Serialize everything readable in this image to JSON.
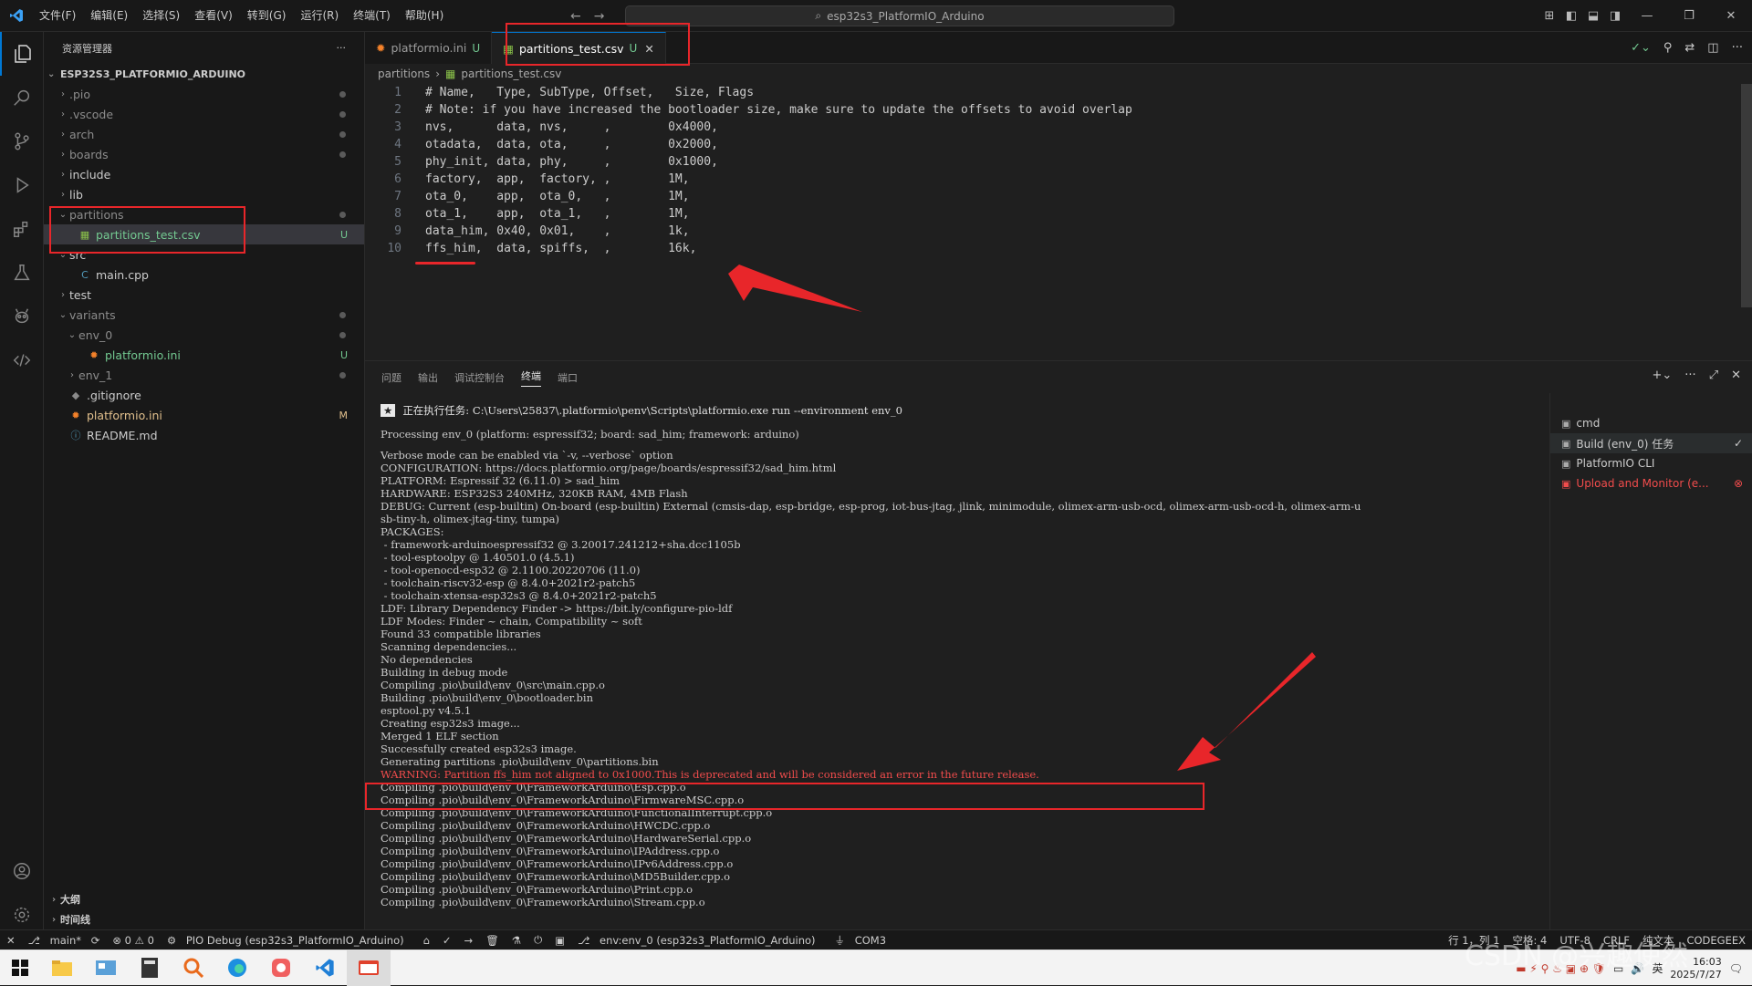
{
  "app": {
    "menu": [
      "文件(F)",
      "编辑(E)",
      "选择(S)",
      "查看(V)",
      "转到(G)",
      "运行(R)",
      "终端(T)",
      "帮助(H)"
    ],
    "search_text": "esp32s3_PlatformIO_Arduino"
  },
  "sidebar": {
    "title": "资源管理器",
    "root": "ESP32S3_PLATFORMIO_ARDUINO",
    "items": [
      {
        "label": ".pio",
        "type": "folder",
        "indent": 1,
        "open": false,
        "dot": true
      },
      {
        "label": ".vscode",
        "type": "folder",
        "indent": 1,
        "open": false,
        "dot": true
      },
      {
        "label": "arch",
        "type": "folder",
        "indent": 1,
        "open": false,
        "dot": true
      },
      {
        "label": "boards",
        "type": "folder",
        "indent": 1,
        "open": false,
        "dot": true
      },
      {
        "label": "include",
        "type": "folder",
        "indent": 1,
        "open": false,
        "dot": false
      },
      {
        "label": "lib",
        "type": "folder",
        "indent": 1,
        "open": false,
        "dot": false
      },
      {
        "label": "partitions",
        "type": "folder",
        "indent": 1,
        "open": true,
        "dot": true
      },
      {
        "label": "partitions_test.csv",
        "type": "csv",
        "indent": 2,
        "badge": "U",
        "selected": true
      },
      {
        "label": "src",
        "type": "folder",
        "indent": 1,
        "open": true,
        "dot": false
      },
      {
        "label": "main.cpp",
        "type": "cpp",
        "indent": 2
      },
      {
        "label": "test",
        "type": "folder",
        "indent": 1,
        "open": false,
        "dot": false
      },
      {
        "label": "variants",
        "type": "folder",
        "indent": 1,
        "open": true,
        "dot": true
      },
      {
        "label": "env_0",
        "type": "folder",
        "indent": 2,
        "open": true,
        "dot": true
      },
      {
        "label": "platformio.ini",
        "type": "ini",
        "indent": 3,
        "badge": "U"
      },
      {
        "label": "env_1",
        "type": "folder",
        "indent": 2,
        "open": false,
        "dot": true
      },
      {
        "label": ".gitignore",
        "type": "git",
        "indent": 1
      },
      {
        "label": "platformio.ini",
        "type": "ini",
        "indent": 1,
        "badge": "M"
      },
      {
        "label": "README.md",
        "type": "md",
        "indent": 1
      }
    ],
    "bottom": [
      "大纲",
      "时间线"
    ]
  },
  "editor": {
    "tabs": [
      {
        "label": "platformio.ini",
        "badge": "U",
        "active": false
      },
      {
        "label": "partitions_test.csv",
        "badge": "U",
        "active": true
      }
    ],
    "breadcrumb": [
      "partitions",
      "partitions_test.csv"
    ],
    "lines": [
      "# Name,   Type, SubType, Offset,   Size, Flags",
      "# Note: if you have increased the bootloader size, make sure to update the offsets to avoid overlap",
      "nvs,      data, nvs,     ,        0x4000,",
      "otadata,  data, ota,     ,        0x2000,",
      "phy_init, data, phy,     ,        0x1000,",
      "factory,  app,  factory, ,        1M,",
      "ota_0,    app,  ota_0,   ,        1M,",
      "ota_1,    app,  ota_1,   ,        1M,",
      "data_him, 0x40, 0x01,    ,        1k,",
      "ffs_him,  data, spiffs,  ,        16k,"
    ]
  },
  "panel": {
    "tabs": [
      "问题",
      "输出",
      "调试控制台",
      "终端",
      "端口"
    ],
    "active_tab": "终端",
    "task_line": "正在执行任务: C:\\Users\\25837\\.platformio\\penv\\Scripts\\platformio.exe run --environment env_0",
    "processing": "Processing env_0 (platform: espressif32; board: sad_him; framework: arduino)",
    "output": [
      "Verbose mode can be enabled via `-v, --verbose` option",
      "CONFIGURATION: https://docs.platformio.org/page/boards/espressif32/sad_him.html",
      "PLATFORM: Espressif 32 (6.11.0) > sad_him",
      "HARDWARE: ESP32S3 240MHz, 320KB RAM, 4MB Flash",
      "DEBUG: Current (esp-builtin) On-board (esp-builtin) External (cmsis-dap, esp-bridge, esp-prog, iot-bus-jtag, jlink, minimodule, olimex-arm-usb-ocd, olimex-arm-usb-ocd-h, olimex-arm-u",
      "sb-tiny-h, olimex-jtag-tiny, tumpa)",
      "PACKAGES:",
      " - framework-arduinoespressif32 @ 3.20017.241212+sha.dcc1105b",
      " - tool-esptoolpy @ 1.40501.0 (4.5.1)",
      " - tool-openocd-esp32 @ 2.1100.20220706 (11.0)",
      " - toolchain-riscv32-esp @ 8.4.0+2021r2-patch5",
      " - toolchain-xtensa-esp32s3 @ 8.4.0+2021r2-patch5",
      "LDF: Library Dependency Finder -> https://bit.ly/configure-pio-ldf",
      "LDF Modes: Finder ~ chain, Compatibility ~ soft",
      "Found 33 compatible libraries",
      "Scanning dependencies...",
      "No dependencies",
      "Building in debug mode",
      "Compiling .pio\\build\\env_0\\src\\main.cpp.o",
      "Building .pio\\build\\env_0\\bootloader.bin",
      "esptool.py v4.5.1",
      "Creating esp32s3 image...",
      "Merged 1 ELF section",
      "Successfully created esp32s3 image.",
      "Generating partitions .pio\\build\\env_0\\partitions.bin"
    ],
    "warning": "WARNING: Partition ffs_him not aligned to 0x1000.This is deprecated and will be considered an error in the future release.",
    "output2": [
      "Compiling .pio\\build\\env_0\\FrameworkArduino\\Esp.cpp.o",
      "Compiling .pio\\build\\env_0\\FrameworkArduino\\FirmwareMSC.cpp.o",
      "Compiling .pio\\build\\env_0\\FrameworkArduino\\FunctionalInterrupt.cpp.o",
      "Compiling .pio\\build\\env_0\\FrameworkArduino\\HWCDC.cpp.o",
      "Compiling .pio\\build\\env_0\\FrameworkArduino\\HardwareSerial.cpp.o",
      "Compiling .pio\\build\\env_0\\FrameworkArduino\\IPAddress.cpp.o",
      "Compiling .pio\\build\\env_0\\FrameworkArduino\\IPv6Address.cpp.o",
      "Compiling .pio\\build\\env_0\\FrameworkArduino\\MD5Builder.cpp.o",
      "Compiling .pio\\build\\env_0\\FrameworkArduino\\Print.cpp.o",
      "Compiling .pio\\build\\env_0\\FrameworkArduino\\Stream.cpp.o"
    ],
    "tasks": [
      {
        "label": "cmd",
        "end": ""
      },
      {
        "label": "Build (env_0) 任务",
        "end": "✓"
      },
      {
        "label": "PlatformIO CLI",
        "end": ""
      },
      {
        "label": "Upload and Monitor (e...",
        "end": "⊗"
      }
    ]
  },
  "statusbar": {
    "left": [
      "main*",
      "⊗ 0 ⚠ 0",
      "PIO Debug (esp32s3_PlatformIO_Arduino)",
      "env:env_0 (esp32s3_PlatformIO_Arduino)",
      "COM3"
    ],
    "right": [
      "行 1，列 1",
      "空格: 4",
      "UTF-8",
      "CRLF",
      "纯文本",
      "CODEGEEX"
    ]
  },
  "taskbar": {
    "ime": "英",
    "time": "16:03",
    "date": "2025/7/27",
    "watermark": "CSDN @兴趣使然"
  },
  "colors": {
    "accent": "#0078d4",
    "annotation": "#e8262a",
    "warning": "#f14c4c",
    "untracked": "#73c991",
    "modified": "#e2c08d"
  }
}
